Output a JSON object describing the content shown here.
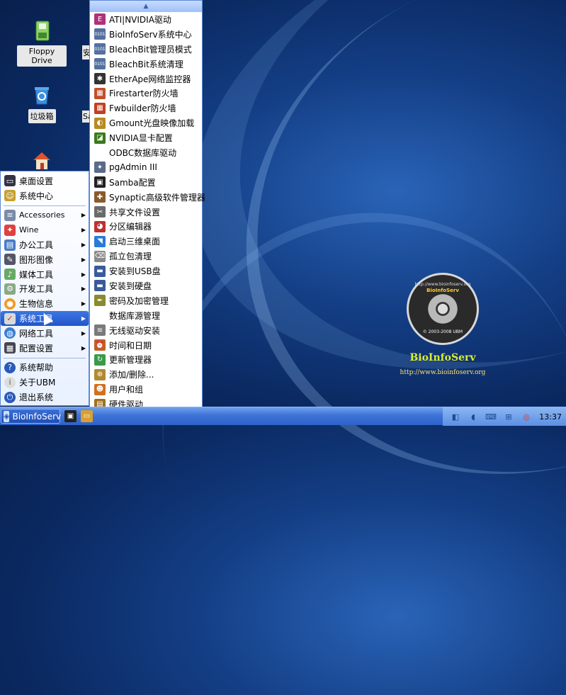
{
  "desktop": {
    "icons": [
      {
        "label": "Floppy Drive",
        "icon": "floppy-icon"
      },
      {
        "label": "垃圾箱",
        "icon": "trash-icon"
      },
      {
        "label": "",
        "icon": "home-icon"
      }
    ],
    "partial_labels": [
      "安",
      "Sa"
    ]
  },
  "logo": {
    "disc_top": "http://www.bioinfoserv.org",
    "disc_brand": "BioInfoServ",
    "disc_bottom": "© 2003-2008 UBM",
    "name": "BioInfoServ",
    "url": "http://www.bioinfoserv.org"
  },
  "start_menu": {
    "top_items": [
      {
        "label": "桌面设置",
        "icon": "monitor-icon"
      },
      {
        "label": "系统中心",
        "icon": "control-center-icon"
      }
    ],
    "cat_items": [
      {
        "label": "Accessories",
        "icon": "accessories-icon"
      },
      {
        "label": "Wine",
        "icon": "wine-icon"
      },
      {
        "label": "办公工具",
        "icon": "office-icon"
      },
      {
        "label": "图形图像",
        "icon": "graphics-icon"
      },
      {
        "label": "媒体工具",
        "icon": "media-icon"
      },
      {
        "label": "开发工具",
        "icon": "development-icon"
      },
      {
        "label": "生物信息",
        "icon": "bioinformatics-icon"
      },
      {
        "label": "系统工具",
        "icon": "system-tools-icon"
      },
      {
        "label": "网络工具",
        "icon": "network-icon"
      },
      {
        "label": "配置设置",
        "icon": "settings-icon"
      }
    ],
    "bottom_items": [
      {
        "label": "系统帮助",
        "icon": "help-icon"
      },
      {
        "label": "关于UBM",
        "icon": "info-icon"
      },
      {
        "label": "退出系统",
        "icon": "power-icon"
      }
    ]
  },
  "submenu": {
    "items": [
      {
        "label": "ATI|NVIDIA驱动",
        "icon": "driver-icon"
      },
      {
        "label": "BioInfoServ系统中心",
        "icon": "binary-icon"
      },
      {
        "label": "BleachBit管理员模式",
        "icon": "binary-icon"
      },
      {
        "label": "BleachBit系统清理",
        "icon": "binary-icon"
      },
      {
        "label": "EtherApe网络监控器",
        "icon": "ant-icon"
      },
      {
        "label": "Firestarter防火墙",
        "icon": "firewall-icon"
      },
      {
        "label": "Fwbuilder防火墙",
        "icon": "firewall-builder-icon"
      },
      {
        "label": "Gmount光盘映像加载",
        "icon": "disc-mount-icon"
      },
      {
        "label": "NVIDIA显卡配置",
        "icon": "nvidia-icon"
      },
      {
        "label": "ODBC数据库驱动",
        "icon": ""
      },
      {
        "label": "pgAdmin III",
        "icon": "elephant-icon"
      },
      {
        "label": "Samba配置",
        "icon": "samba-icon"
      },
      {
        "label": "Synaptic高级软件管理器",
        "icon": "package-manager-icon"
      },
      {
        "label": "共享文件设置",
        "icon": "share-icon"
      },
      {
        "label": "分区编辑器",
        "icon": "partition-icon"
      },
      {
        "label": "启动三维桌面",
        "icon": "3d-desktop-icon"
      },
      {
        "label": "孤立包清理",
        "icon": "orphan-cleanup-icon"
      },
      {
        "label": "安装到USB盘",
        "icon": "usb-install-icon"
      },
      {
        "label": "安装到硬盘",
        "icon": "hdd-install-icon"
      },
      {
        "label": "密码及加密管理",
        "icon": "key-icon"
      },
      {
        "label": "数据库源管理",
        "icon": ""
      },
      {
        "label": "无线驱动安装",
        "icon": "wireless-icon"
      },
      {
        "label": "时间和日期",
        "icon": "clock-icon"
      },
      {
        "label": "更新管理器",
        "icon": "update-icon"
      },
      {
        "label": "添加/删除...",
        "icon": "add-remove-icon"
      },
      {
        "label": "用户和组",
        "icon": "users-icon"
      },
      {
        "label": "硬件驱动",
        "icon": "hardware-icon"
      }
    ]
  },
  "taskbar": {
    "start_label": "BioInfoServ",
    "clock": "13:37"
  }
}
